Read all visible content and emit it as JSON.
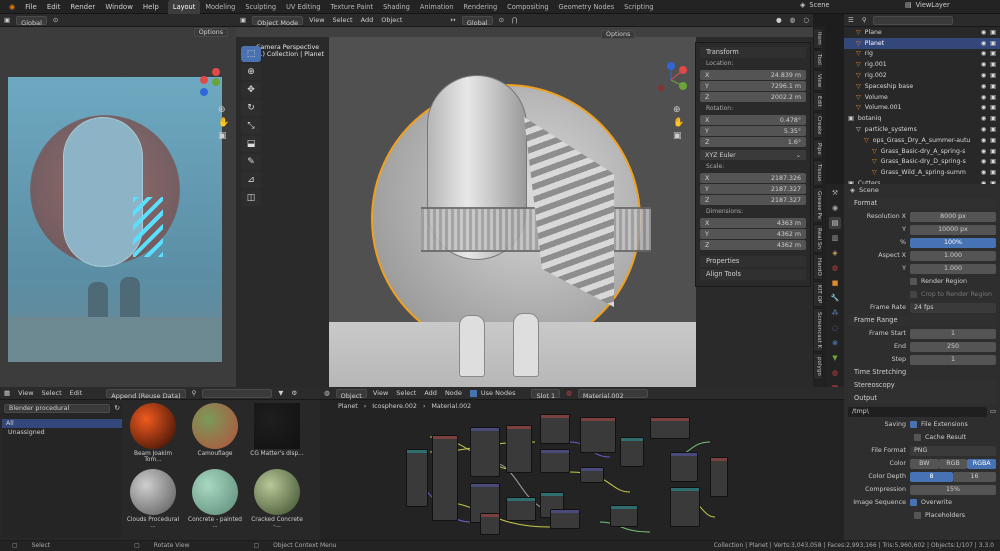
{
  "topbar": {
    "menu": [
      "File",
      "Edit",
      "Render",
      "Window",
      "Help"
    ],
    "workspaces": [
      "Layout",
      "Modeling",
      "Sculpting",
      "UV Editing",
      "Texture Paint",
      "Shading",
      "Animation",
      "Rendering",
      "Compositing",
      "Geometry Nodes",
      "Scripting"
    ],
    "active_workspace": "Layout",
    "scene": "Scene",
    "view_layer": "ViewLayer"
  },
  "left_view": {
    "orientation": "Global",
    "options": "Options"
  },
  "viewport": {
    "mode": "Object Mode",
    "menu": [
      "View",
      "Select",
      "Add",
      "Object"
    ],
    "orientation": "Global",
    "options": "Options",
    "camera_label": "Camera Perspective",
    "collection_label": "(1) Collection | Planet"
  },
  "transform": {
    "title": "Transform",
    "location_label": "Location:",
    "location": [
      {
        "axis": "X",
        "value": "24.839 m"
      },
      {
        "axis": "Y",
        "value": "7296.1 m"
      },
      {
        "axis": "Z",
        "value": "2002.2 m"
      }
    ],
    "rotation_label": "Rotation:",
    "rotation": [
      {
        "axis": "X",
        "value": "0.478°"
      },
      {
        "axis": "Y",
        "value": "5.35°"
      },
      {
        "axis": "Z",
        "value": "1.6°"
      }
    ],
    "rotation_mode": "XYZ Euler",
    "scale_label": "Scale:",
    "scale": [
      {
        "axis": "X",
        "value": "2187.326"
      },
      {
        "axis": "Y",
        "value": "2187.327"
      },
      {
        "axis": "Z",
        "value": "2187.327"
      }
    ],
    "dimensions_label": "Dimensions:",
    "dimensions": [
      {
        "axis": "X",
        "value": "4363 m"
      },
      {
        "axis": "Y",
        "value": "4362 m"
      },
      {
        "axis": "Z",
        "value": "4362 m"
      }
    ],
    "properties": "Properties",
    "align_tools": "Align Tools"
  },
  "side_tabs": [
    "Item",
    "Tool",
    "View",
    "Edit",
    "Create",
    "Pipe",
    "Tissue",
    "Grease Pe",
    "Real Sn",
    "HardO",
    "KIT OP",
    "Screencast K",
    "polygo"
  ],
  "outliner": {
    "rows": [
      {
        "name": "Plane",
        "indent": 1,
        "color": "#e08a2c"
      },
      {
        "name": "Planet",
        "indent": 1,
        "color": "#e08a2c",
        "selected": true
      },
      {
        "name": "rig",
        "indent": 1,
        "color": "#e08a2c"
      },
      {
        "name": "rig.001",
        "indent": 1,
        "color": "#e08a2c"
      },
      {
        "name": "rig.002",
        "indent": 1,
        "color": "#e08a2c"
      },
      {
        "name": "Spaceship base",
        "indent": 1,
        "color": "#e08a2c"
      },
      {
        "name": "Volume",
        "indent": 1,
        "color": "#e08a2c"
      },
      {
        "name": "Volume.001",
        "indent": 1,
        "color": "#e08a2c"
      },
      {
        "name": "botaniq",
        "indent": 0,
        "color": "#d0d0d0"
      },
      {
        "name": "particle_systems",
        "indent": 1,
        "color": "#d0d0d0"
      },
      {
        "name": "ops_Grass_Dry_A_summer-autu",
        "indent": 2,
        "color": "#e08a2c"
      },
      {
        "name": "Grass_Basic-dry_A_spring-s",
        "indent": 3,
        "color": "#e08a2c"
      },
      {
        "name": "Grass_Basic-dry_D_spring-s",
        "indent": 3,
        "color": "#e08a2c"
      },
      {
        "name": "Grass_Wild_A_spring-summ",
        "indent": 3,
        "color": "#e08a2c"
      },
      {
        "name": "Cutters",
        "indent": 0,
        "color": "#d0d0d0"
      }
    ]
  },
  "properties": {
    "scene_label": "Scene",
    "format": {
      "title": "Format",
      "resolution_x_label": "Resolution X",
      "resolution_x": "8000 px",
      "y_label": "Y",
      "resolution_y": "10000 px",
      "percent_label": "%",
      "percent": "100%",
      "aspect_x_label": "Aspect X",
      "aspect_x": "1.000",
      "aspect_y_label": "Y",
      "aspect_y": "1.000",
      "render_region": "Render Region",
      "crop": "Crop to Render Region",
      "frame_rate_label": "Frame Rate",
      "frame_rate": "24 fps"
    },
    "frame_range": {
      "title": "Frame Range",
      "start_label": "Frame Start",
      "start": "1",
      "end_label": "End",
      "end": "250",
      "step_label": "Step",
      "step": "1"
    },
    "time_stretching": "Time Stretching",
    "stereoscopy": "Stereoscopy",
    "output": {
      "title": "Output",
      "path": "/tmp\\",
      "saving_label": "Saving",
      "file_extensions": "File Extensions",
      "cache_result": "Cache Result",
      "file_format_label": "File Format",
      "file_format": "PNG",
      "color_label": "Color",
      "color_options": [
        "BW",
        "RGB",
        "RGBA"
      ],
      "depth_label": "Color Depth",
      "depth_options": [
        "8",
        "16"
      ],
      "compression_label": "Compression",
      "compression": "15%",
      "image_sequence_label": "Image Sequence",
      "overwrite": "Overwrite",
      "placeholders": "Placeholders"
    }
  },
  "asset_browser": {
    "menu": [
      "View",
      "Select",
      "Edit"
    ],
    "import_mode": "Append (Reuse Data)",
    "library": "Blender procedural",
    "catalogs": [
      "All",
      "Unassigned"
    ],
    "assets": [
      {
        "name": "Beam Joakim Tom...",
        "color1": "#f05a1e",
        "color2": "#2a0a04"
      },
      {
        "name": "Camouflage",
        "color1": "#7a9a5a",
        "color2": "#b5503a"
      },
      {
        "name": "CG Matter's disp...",
        "color1": "#1e1e1e",
        "color2": "#111111"
      },
      {
        "name": "Clouds Procedural ...",
        "color1": "#cfcfcf",
        "color2": "#555555"
      },
      {
        "name": "Concrete - painted ...",
        "color1": "#a8d8c0",
        "color2": "#5a8a78"
      },
      {
        "name": "Cracked Concrete -...",
        "color1": "#b8c898",
        "color2": "#3a4a2a"
      }
    ]
  },
  "node_editor": {
    "object": "Object",
    "menu": [
      "View",
      "Select",
      "Add",
      "Node"
    ],
    "use_nodes": "Use Nodes",
    "slot": "Slot 1",
    "material": "Material.002",
    "breadcrumbs": [
      "Planet",
      "Icosphere.002",
      "Material.002"
    ]
  },
  "status": {
    "left": [
      "Select",
      "Rotate View",
      "Object Context Menu"
    ],
    "right": "Collection | Planet | Verts:3,043,058 | Faces:2,993,166 | Tris:5,960,602 | Objects:1/107 | 3.3.0"
  }
}
